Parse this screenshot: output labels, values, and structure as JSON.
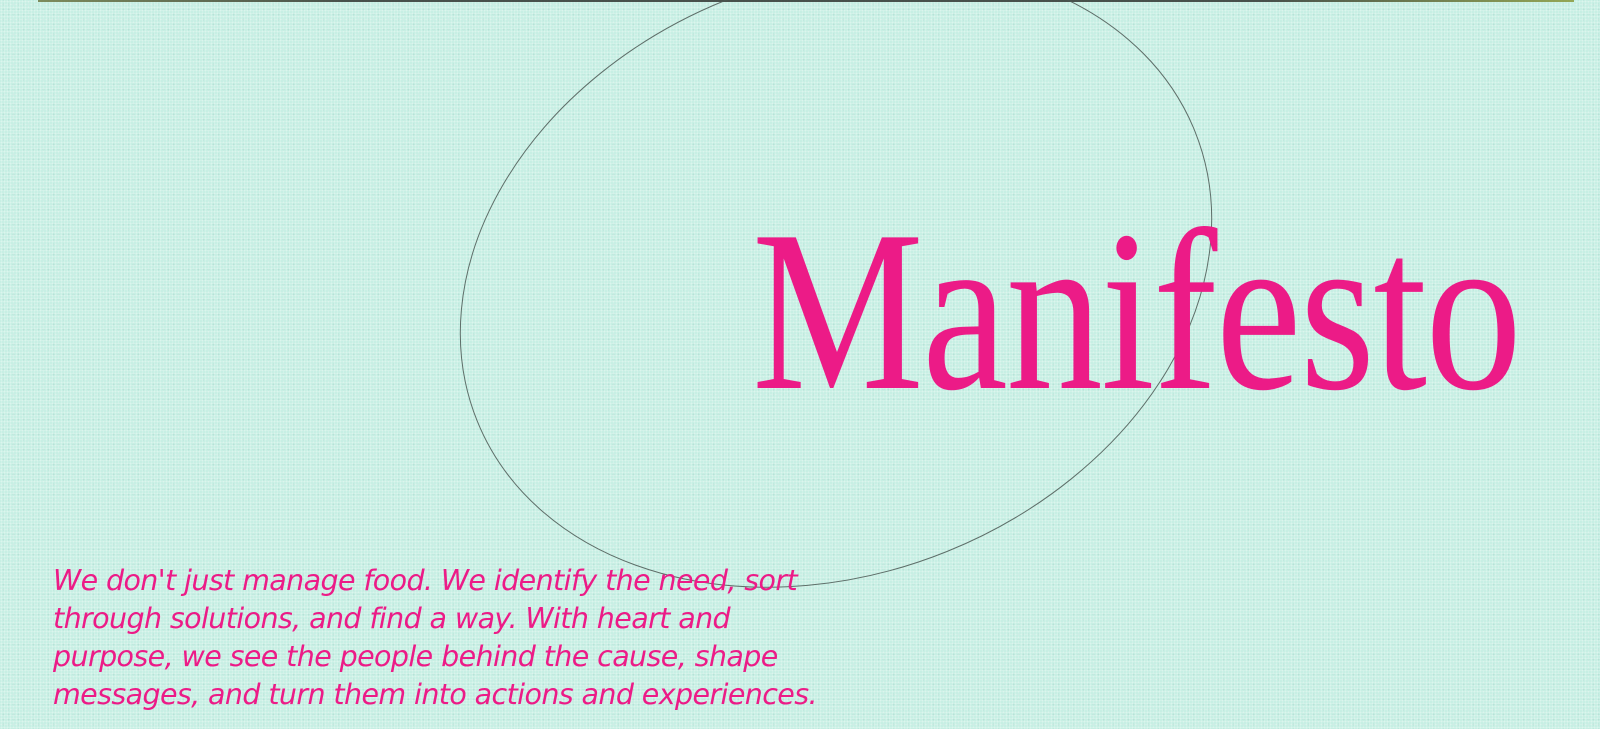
{
  "colors": {
    "background": "#c7efe4",
    "accent": "#ec1b87",
    "outline": "#4a5752"
  },
  "hero": {
    "title": "Manifesto"
  },
  "manifesto": {
    "text": "We don't just manage food. We identify the need, sort through solutions, and find a way. With heart and purpose, we see the people behind the cause, shape messages, and turn them into actions and experiences."
  }
}
